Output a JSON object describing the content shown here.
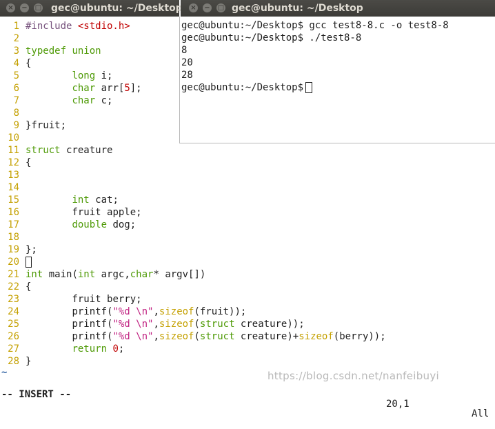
{
  "editor_window": {
    "title": "gec@ubuntu: ~/Desktop",
    "buttons": [
      "×",
      "−",
      "□"
    ]
  },
  "terminal_window": {
    "title": "gec@ubuntu: ~/Desktop",
    "buttons": [
      "×",
      "−",
      "□"
    ]
  },
  "terminal": {
    "lines": [
      "gec@ubuntu:~/Desktop$ gcc test8-8.c -o test8-8",
      "gec@ubuntu:~/Desktop$ ./test8-8",
      "8",
      "20",
      "28"
    ],
    "prompt": "gec@ubuntu:~/Desktop$"
  },
  "vim": {
    "mode": "-- INSERT --",
    "cursor_position": "20,1",
    "scroll": "All",
    "tilde": "~",
    "watermark": "https://blog.csdn.net/nanfeibuyi",
    "line_numbers": [
      "1",
      "2",
      "3",
      "4",
      "5",
      "6",
      "7",
      "8",
      "9",
      "10",
      "11",
      "12",
      "13",
      "14",
      "15",
      "16",
      "17",
      "18",
      "19",
      "20",
      "21",
      "22",
      "23",
      "24",
      "25",
      "26",
      "27",
      "28"
    ],
    "code": {
      "l1_pp": "#include ",
      "l1_hdr": "<stdio.h>",
      "l3_a": "typedef",
      "l3_b": "union",
      "l4": "{",
      "l5_type": "long",
      "l5_rest": " i;",
      "l6_type": "char",
      "l6_mid": " arr[",
      "l6_num": "5",
      "l6_end": "];",
      "l7_type": "char",
      "l7_rest": " c;",
      "l9": "}fruit;",
      "l11_kw": "struct",
      "l11_rest": " creature",
      "l12": "{",
      "l15_type": "int",
      "l15_rest": " cat;",
      "l16": "fruit apple;",
      "l17_type": "double",
      "l17_rest": " dog;",
      "l19": "};",
      "l21_type": "int",
      "l21_a": " main(",
      "l21_type2": "int",
      "l21_b": " argc,",
      "l21_type3": "char",
      "l21_c": "* argv[])",
      "l22": "{",
      "l23": "fruit berry;",
      "l24_a": "printf(",
      "l24_str": "\"%d \\n\"",
      "l24_b": ",",
      "l24_fn": "sizeof",
      "l24_c": "(fruit));",
      "l25_a": "printf(",
      "l25_str": "\"%d \\n\"",
      "l25_b": ",",
      "l25_fn": "sizeof",
      "l25_c": "(",
      "l25_kw": "struct",
      "l25_d": " creature));",
      "l26_a": "printf(",
      "l26_str": "\"%d \\n\"",
      "l26_b": ",",
      "l26_fn": "sizeof",
      "l26_c": "(",
      "l26_kw": "struct",
      "l26_d": " creature)+",
      "l26_fn2": "sizeof",
      "l26_e": "(berry));",
      "l27_kw": "return",
      "l27_num": "0",
      "l27_end": ";",
      "l28": "}"
    }
  }
}
